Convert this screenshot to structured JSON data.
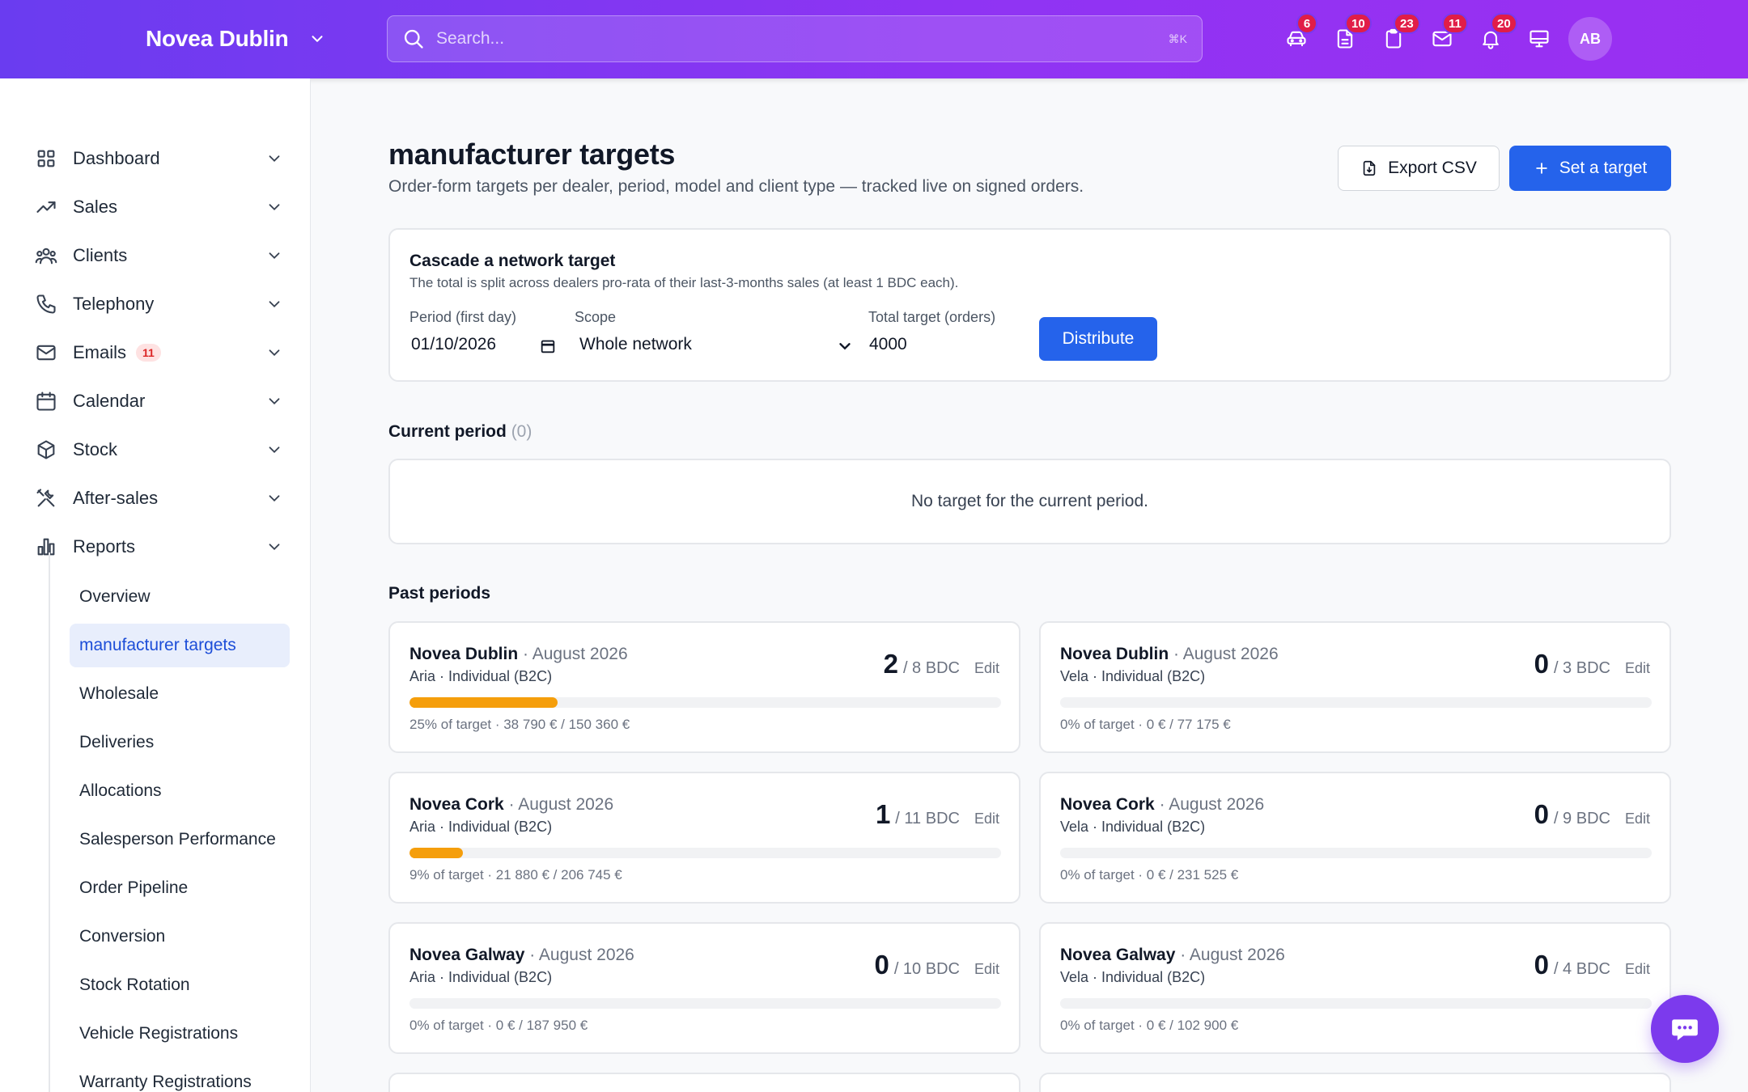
{
  "brand": {
    "name": "Novea Dublin"
  },
  "search": {
    "placeholder": "Search...",
    "shortcut": "⌘K"
  },
  "top_icons": [
    {
      "name": "car-icon",
      "badge": "6"
    },
    {
      "name": "document-icon",
      "badge": "10"
    },
    {
      "name": "clipboard-icon",
      "badge": "23"
    },
    {
      "name": "mail-icon",
      "badge": "11"
    },
    {
      "name": "bell-icon",
      "badge": "20"
    },
    {
      "name": "monitor-icon",
      "badge": ""
    }
  ],
  "user": {
    "initials": "AB"
  },
  "sidebar": {
    "items": [
      {
        "label": "Dashboard",
        "icon": "grid-icon"
      },
      {
        "label": "Sales",
        "icon": "trend-icon"
      },
      {
        "label": "Clients",
        "icon": "users-icon"
      },
      {
        "label": "Telephony",
        "icon": "phone-icon"
      },
      {
        "label": "Emails",
        "icon": "mail-icon",
        "badge": "11"
      },
      {
        "label": "Calendar",
        "icon": "calendar-icon"
      },
      {
        "label": "Stock",
        "icon": "box-icon"
      },
      {
        "label": "After-sales",
        "icon": "tools-icon"
      },
      {
        "label": "Reports",
        "icon": "chart-icon"
      }
    ],
    "reports_sub": [
      "Overview",
      "manufacturer targets",
      "Wholesale",
      "Deliveries",
      "Allocations",
      "Salesperson Performance",
      "Order Pipeline",
      "Conversion",
      "Stock Rotation",
      "Vehicle Registrations",
      "Warranty Registrations"
    ],
    "active_sub": "manufacturer targets"
  },
  "page": {
    "title": "manufacturer targets",
    "subtitle": "Order-form targets per dealer, period, model and client type — tracked live on signed orders.",
    "export_label": "Export CSV",
    "set_target_label": "Set a target"
  },
  "cascade": {
    "title": "Cascade a network target",
    "description": "The total is split across dealers pro-rata of their last-3-months sales (at least 1 BDC each).",
    "period_label": "Period (first day)",
    "period_value": "01/10/2026",
    "scope_label": "Scope",
    "scope_value": "Whole network",
    "total_label": "Total target (orders)",
    "total_value": "4000",
    "distribute_label": "Distribute"
  },
  "current_period": {
    "title": "Current period",
    "count": "(0)",
    "empty_text": "No target for the current period."
  },
  "past_periods": {
    "title": "Past periods",
    "edit_label": "Edit",
    "cards": [
      {
        "dealer": "Novea Dublin",
        "period": "August 2026",
        "model": "Aria · Individual (B2C)",
        "count": "2",
        "target": "/ 8 BDC",
        "progress": 0.25,
        "footer": "25% of target · 38 790 € / 150 360 €"
      },
      {
        "dealer": "Novea Dublin",
        "period": "August 2026",
        "model": "Vela · Individual (B2C)",
        "count": "0",
        "target": "/ 3 BDC",
        "progress": 0,
        "footer": "0% of target · 0 € / 77 175 €"
      },
      {
        "dealer": "Novea Cork",
        "period": "August 2026",
        "model": "Aria · Individual (B2C)",
        "count": "1",
        "target": "/ 11 BDC",
        "progress": 0.09,
        "footer": "9% of target · 21 880 € / 206 745 €"
      },
      {
        "dealer": "Novea Cork",
        "period": "August 2026",
        "model": "Vela · Individual (B2C)",
        "count": "0",
        "target": "/ 9 BDC",
        "progress": 0,
        "footer": "0% of target · 0 € / 231 525 €"
      },
      {
        "dealer": "Novea Galway",
        "period": "August 2026",
        "model": "Aria · Individual (B2C)",
        "count": "0",
        "target": "/ 10 BDC",
        "progress": 0,
        "footer": "0% of target · 0 € / 187 950 €"
      },
      {
        "dealer": "Novea Galway",
        "period": "August 2026",
        "model": "Vela · Individual (B2C)",
        "count": "0",
        "target": "/ 4 BDC",
        "progress": 0,
        "footer": "0% of target · 0 € / 102 900 €"
      }
    ]
  },
  "colors": {
    "accent": "#2563eb",
    "brand_gradient_start": "#6a3cf0",
    "brand_gradient_end": "#9a2ff2",
    "progress": "#f59e0b",
    "badge": "#e11d48"
  }
}
